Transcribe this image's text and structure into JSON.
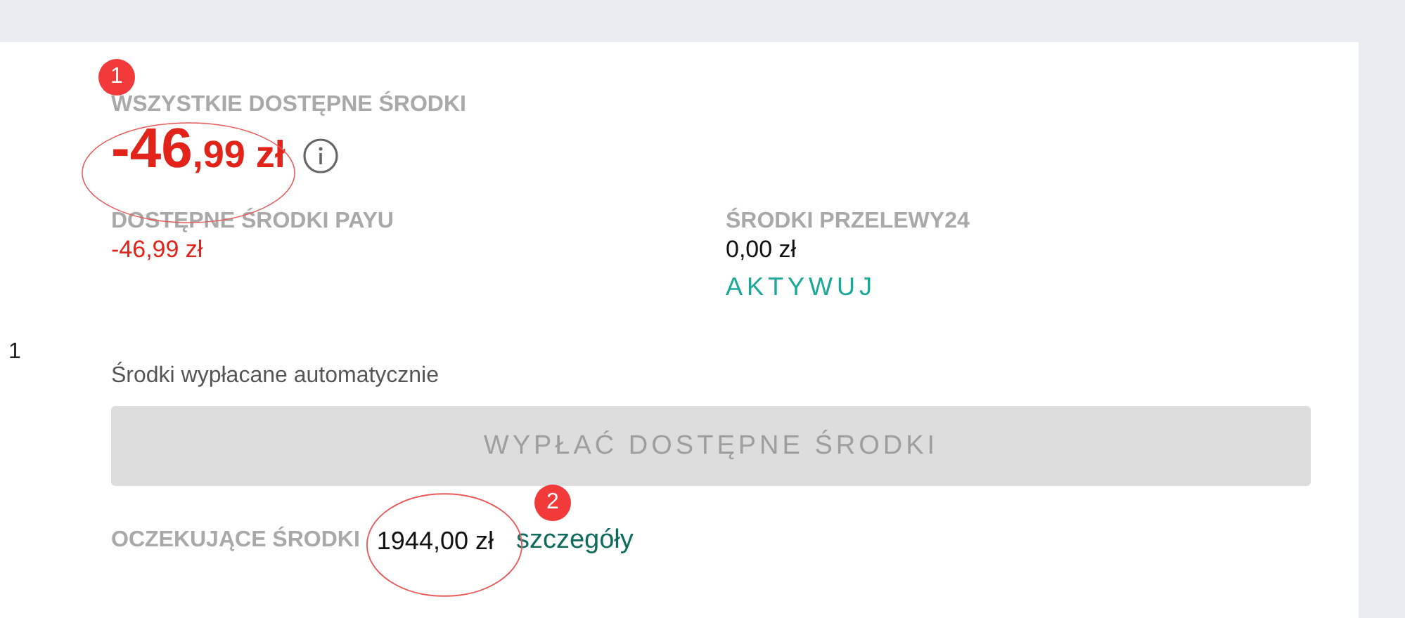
{
  "side_text": "1",
  "total": {
    "label": "WSZYSTKIE DOSTĘPNE ŚRODKI",
    "amount_main": "-46",
    "amount_rest": ",99 zł",
    "negative": true,
    "annotation": "1"
  },
  "balances": [
    {
      "label": "DOSTĘPNE ŚRODKI PAYU",
      "value": "-46,99 zł",
      "negative": true
    },
    {
      "label": "ŚRODKI PRZELEWY24",
      "value": "0,00 zł",
      "negative": false,
      "action": "AKTYWUJ"
    }
  ],
  "auto_note": "Środki wypłacane automatycznie",
  "withdraw_button": {
    "label": "WYPŁAĆ DOSTĘPNE ŚRODKI",
    "disabled": true
  },
  "pending": {
    "label": "OCZEKUJĄCE ŚRODKI",
    "value": "1944,00 zł",
    "link": "szczegóły",
    "annotation": "2"
  }
}
